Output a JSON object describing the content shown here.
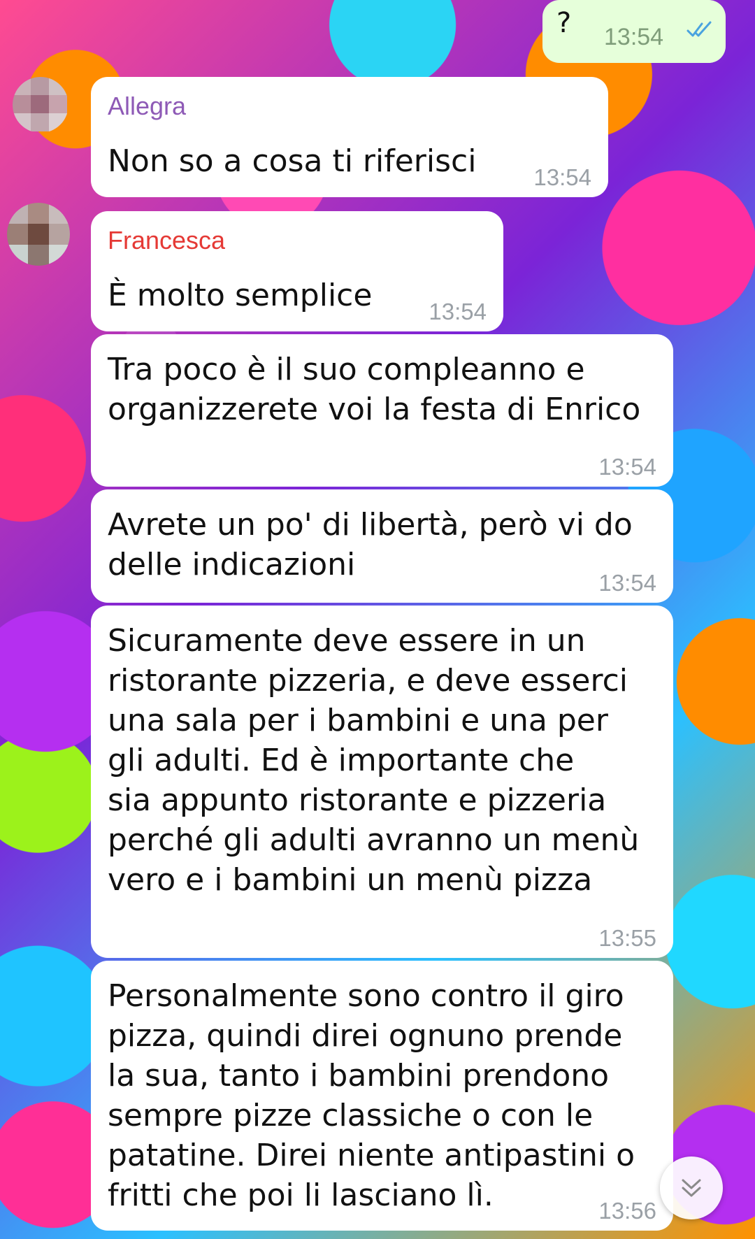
{
  "outgoing": {
    "text": "?",
    "time": "13:54",
    "status_icon": "double-check-icon"
  },
  "messages": [
    {
      "sender": "Allegra",
      "text": "Non so a cosa ti riferisci",
      "time": "13:54",
      "sender_color": "#8e5ab6"
    },
    {
      "sender": "Francesca",
      "text": "È molto semplice",
      "time": "13:54",
      "sender_color": "#e53935"
    },
    {
      "text": "Tra poco è il suo compleanno e\norganizzerete voi la festa di Enrico",
      "time": "13:54"
    },
    {
      "text": "Avrete un po' di libertà, però vi do\ndelle indicazioni",
      "time": "13:54"
    },
    {
      "text": "Sicuramente deve essere in un\nristorante pizzeria, e deve esserci\nuna sala per i bambini e una per\ngli adulti. Ed è importante che\nsia appunto ristorante e pizzeria\nperché gli adulti avranno un menù\nvero e i bambini un menù pizza",
      "time": "13:55"
    },
    {
      "text": "Personalmente sono contro il giro\npizza, quindi direi ognuno prende\nla sua, tanto i bambini prendono\nsempre pizze classiche o con le\npatatine. Direi niente antipastini o\nfritti che poi li lasciano lì.",
      "time": "13:56"
    }
  ],
  "scroll_button": {
    "icon": "chevrons-down-icon"
  },
  "colors": {
    "bubble_incoming": "#ffffff",
    "bubble_outgoing": "#e6ffda",
    "check": "#4aa3df",
    "time": "#9aa0a6"
  }
}
